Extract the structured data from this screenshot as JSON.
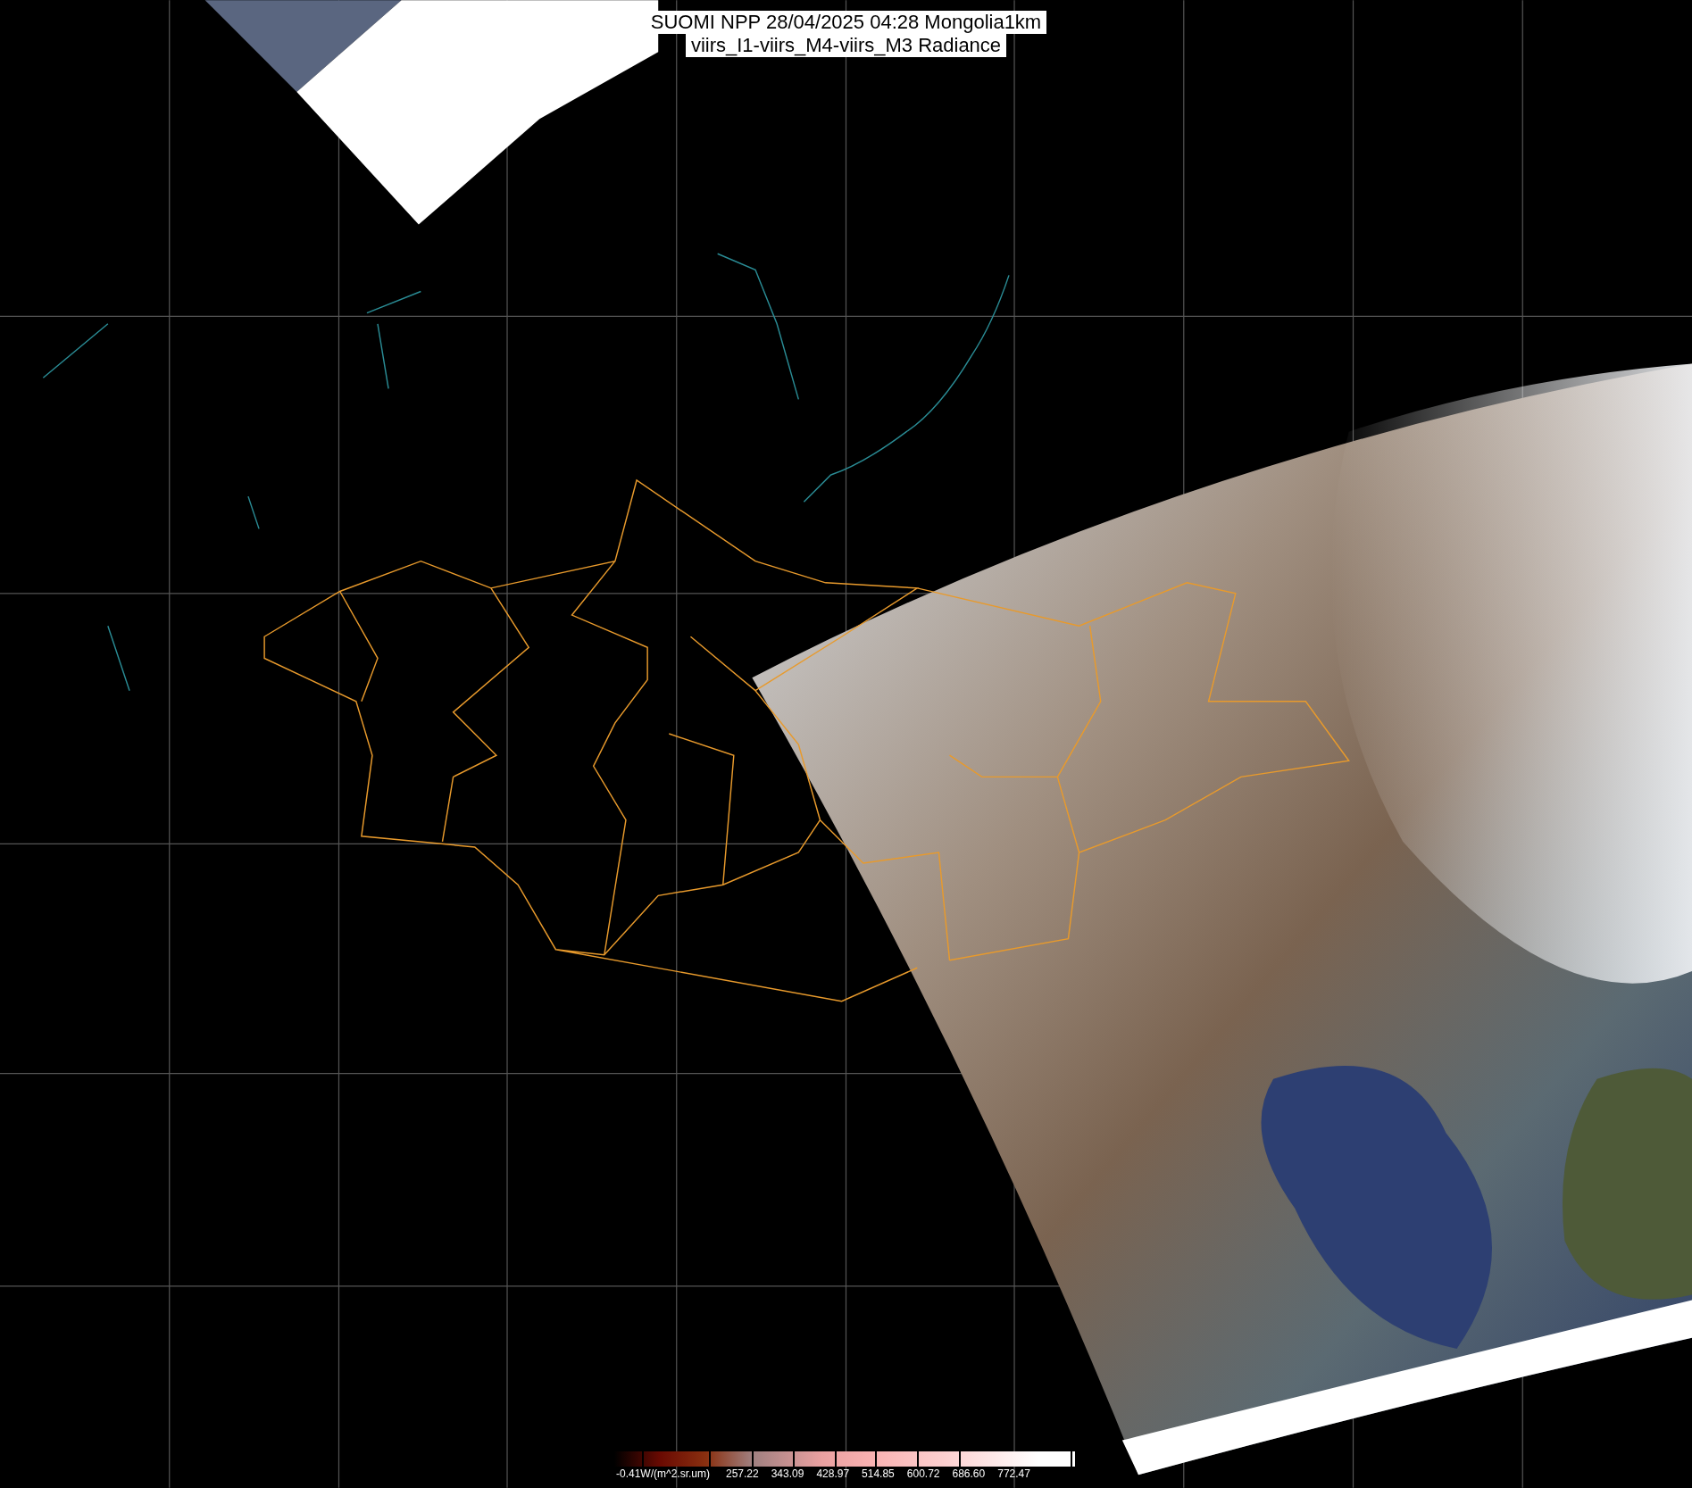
{
  "title": {
    "lines": [
      "SUOMI NPP 28/04/2025 04:28 Mongolia1km",
      "viirs_I1-viirs_M4-viirs_M3 Radiance"
    ]
  },
  "colorbar": {
    "labels": [
      "-0.41W/(m^2.sr.um)",
      "257.22",
      "343.09",
      "428.97",
      "514.85",
      "600.72",
      "686.60",
      "772.47"
    ]
  }
}
